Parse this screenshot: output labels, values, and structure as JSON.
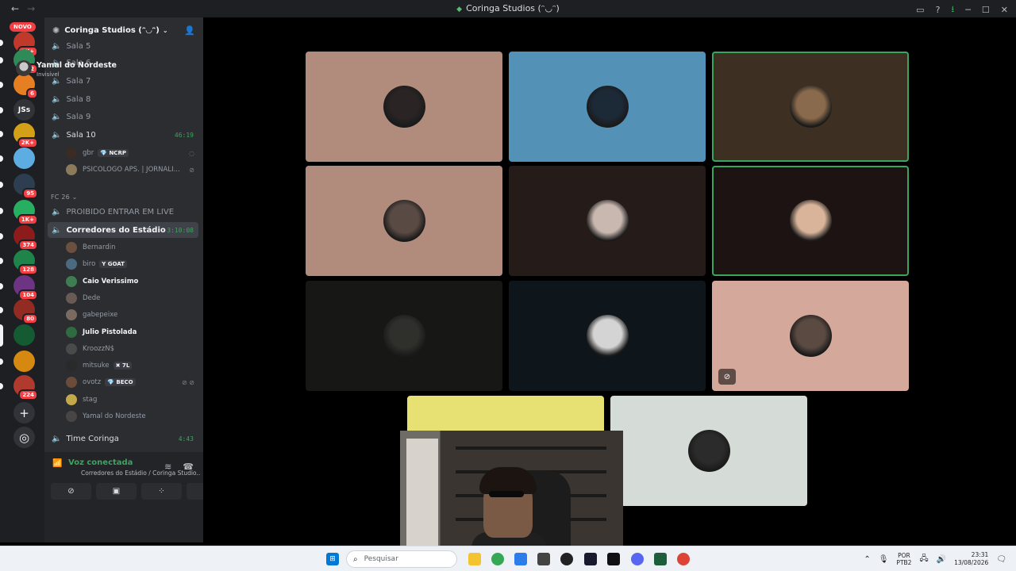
{
  "window": {
    "title": "Coringa Studios (ᵔ◡ᵔ)",
    "nav_back": "←",
    "nav_forward": "→",
    "controls": {
      "inbox": "▭",
      "help": "?",
      "download": "⭳",
      "minimize": "─",
      "maximize": "☐",
      "close": "✕"
    }
  },
  "rail": {
    "novo": "NOVO",
    "servers": [
      {
        "label": "",
        "badge": "1K+",
        "color": "#c0392b"
      },
      {
        "label": "",
        "badge": "642",
        "color": "#2e8b57"
      },
      {
        "label": "",
        "badge": "6",
        "color": "#e67e22"
      },
      {
        "label": "JSs",
        "badge": "",
        "color": "#313338"
      },
      {
        "label": "",
        "badge": "2K+",
        "color": "#d4a017"
      },
      {
        "label": "",
        "badge": "",
        "color": "#5dade2"
      },
      {
        "label": "",
        "badge": "95",
        "color": "#2c3e50"
      },
      {
        "label": "",
        "badge": "1K+",
        "color": "#27ae60"
      },
      {
        "label": "",
        "badge": "374",
        "color": "#8e1b1b"
      },
      {
        "label": "",
        "badge": "128",
        "color": "#1e8449"
      },
      {
        "label": "",
        "badge": "104",
        "color": "#6c3483"
      },
      {
        "label": "",
        "badge": "80",
        "color": "#922b21"
      },
      {
        "label": "",
        "badge": "",
        "color": "#145a32"
      },
      {
        "label": "",
        "badge": "",
        "color": "#d68910"
      },
      {
        "label": "",
        "badge": "224",
        "color": "#b03a2e"
      }
    ],
    "add": "+",
    "explore": "◎"
  },
  "sidebar": {
    "server_name": "Coringa Studios (ᵔ◡ᵔ)",
    "channels_top": [
      {
        "name": "Sala 5"
      },
      {
        "name": "Sala 6"
      },
      {
        "name": "Sala 7"
      },
      {
        "name": "Sala 8"
      },
      {
        "name": "Sala 9"
      }
    ],
    "sala10": {
      "name": "Sala 10",
      "timer": "46:19"
    },
    "sala10_members": [
      {
        "name": "gbr",
        "tag": "💎 NCRP"
      },
      {
        "name": "PSICOLOGO APS. | JORNALI..."
      }
    ],
    "category": "FC 26 ⌄",
    "prohibited": "PROIBIDO ENTRAR EM LIVE",
    "selected": {
      "name": "Corredores do Estádio",
      "timer": "3:10:08"
    },
    "members": [
      {
        "name": "Bernardin",
        "tag": "",
        "bright": false
      },
      {
        "name": "biro",
        "tag": "Y GOAT",
        "bright": false
      },
      {
        "name": "Caio Verissimo",
        "tag": "",
        "bright": true
      },
      {
        "name": "Dede",
        "tag": "",
        "bright": false
      },
      {
        "name": "gabepeixe",
        "tag": "",
        "bright": false
      },
      {
        "name": "Julio Pistolada",
        "tag": "",
        "bright": true
      },
      {
        "name": "KroozzN$",
        "tag": "",
        "bright": false
      },
      {
        "name": "mitsuke",
        "tag": "✖ 7L",
        "bright": false
      },
      {
        "name": "ovotz",
        "tag": "💎 BECO",
        "bright": false
      },
      {
        "name": "stag",
        "tag": "",
        "bright": false
      },
      {
        "name": "Yamal do Nordeste",
        "tag": "",
        "bright": false
      }
    ],
    "time_coringa": {
      "name": "Time Coringa",
      "timer": "4:43"
    }
  },
  "voice": {
    "status": "Voz conectada",
    "channel": "Corredores do Estádio / Coringa Studio...",
    "user_name": "Yamal do Nordeste",
    "user_status": "Invisível"
  },
  "tiles": [
    {
      "bg": "#b18b7b",
      "face": "#2a2424",
      "speaking": false
    },
    {
      "bg": "#5391b7",
      "face": "#1c2a38",
      "speaking": false
    },
    {
      "bg": "#3d2f22",
      "face": "#8a6a4c",
      "speaking": true
    },
    {
      "bg": "#b18b7b",
      "face": "#5a4a44",
      "speaking": false
    },
    {
      "bg": "#251b19",
      "face": "#c9b8b0",
      "speaking": false
    },
    {
      "bg": "#1d1312",
      "face": "#d9b49a",
      "speaking": true
    },
    {
      "bg": "#171815",
      "face": "#2f2f2c",
      "speaking": false
    },
    {
      "bg": "#0f161b",
      "face": "#d4d4d4",
      "speaking": false
    },
    {
      "bg": "#d4a89b",
      "face": "#5b4a42",
      "speaking": false,
      "muted": true
    },
    {
      "bg": "#e7e072",
      "face": "",
      "speaking": false
    },
    {
      "bg": "#d5dcd7",
      "face": "#2b2b2b",
      "speaking": false
    }
  ],
  "taskbar": {
    "search": "Pesquisar",
    "lang_top": "POR",
    "lang_bottom": "PTB2",
    "time": "23:31",
    "date": "13/08/2026"
  }
}
